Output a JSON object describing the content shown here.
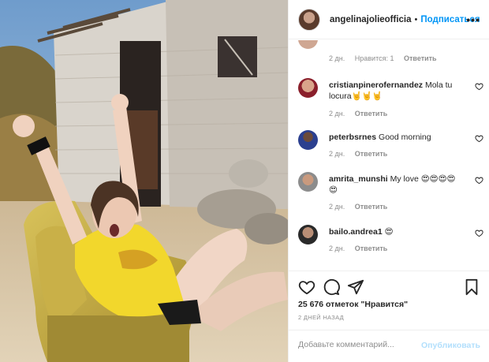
{
  "post": {
    "photo_icon": "post-photo",
    "header": {
      "username": "angelinajolieofficia",
      "separator": "•",
      "follow_label": "Подписаться",
      "more_icon": "more-icon"
    },
    "comments": [
      {
        "username": "",
        "text": "😂😂",
        "time": "2 дн.",
        "likes": "Нравится: 1",
        "reply": "Ответить"
      },
      {
        "username": "cristianpinerofernandez",
        "text": "Mola tu locura🤘🤘🤘",
        "time": "2 дн.",
        "likes": "",
        "reply": "Ответить"
      },
      {
        "username": "peterbsrnes",
        "text": "Good morning",
        "time": "2 дн.",
        "likes": "",
        "reply": "Ответить"
      },
      {
        "username": "amrita_munshi",
        "text": "My love 😍😍😍😍😍",
        "time": "2 дн.",
        "likes": "",
        "reply": "Ответить"
      },
      {
        "username": "bailo.andrea1",
        "text": "😍",
        "time": "2 дн.",
        "likes": "",
        "reply": "Ответить"
      }
    ],
    "likes_count": "25 676 отметок \"Нравится\"",
    "date": "2 ДНЕЙ НАЗАД",
    "add_comment": {
      "placeholder": "Добавьте комментарий...",
      "publish_label": "Опубликовать"
    },
    "colors": {
      "accent": "#0095f6",
      "publish_disabled": "#b2dffc",
      "meta": "#8e8e8e"
    }
  }
}
